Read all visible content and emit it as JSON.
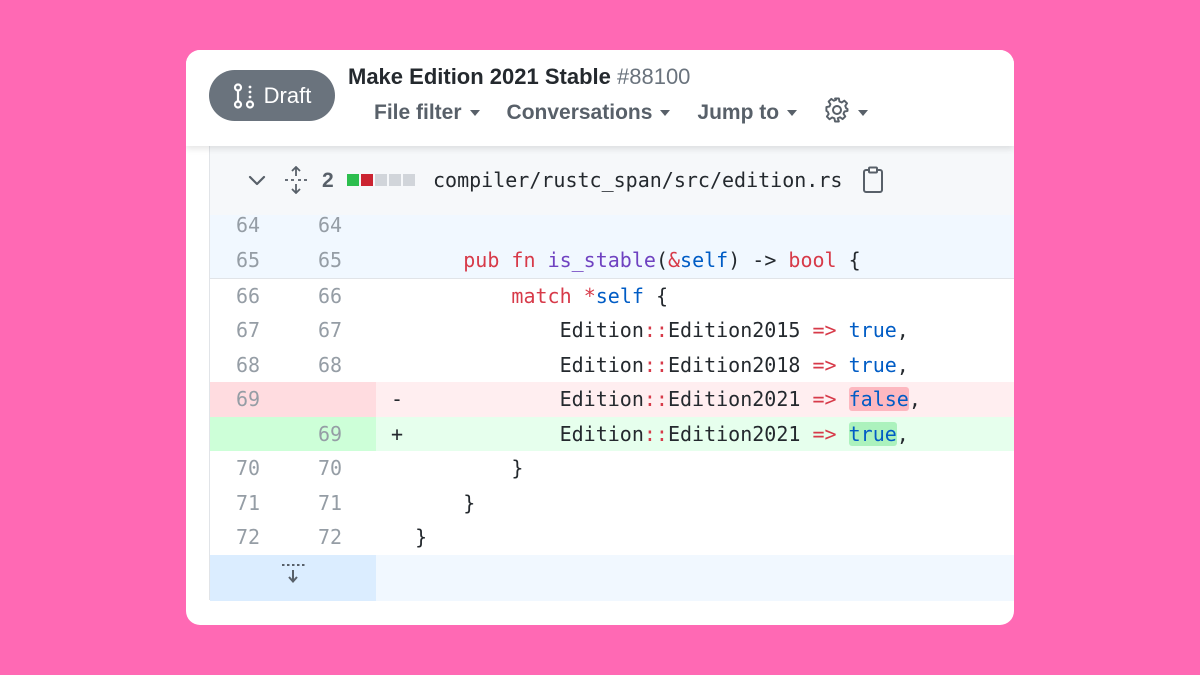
{
  "header": {
    "badge_label": "Draft",
    "title": "Make Edition 2021 Stable",
    "number": "#88100",
    "toolbar": [
      {
        "label": "File filter"
      },
      {
        "label": "Conversations"
      },
      {
        "label": "Jump to"
      }
    ]
  },
  "file": {
    "changes_count": "2",
    "diffstat": [
      "added",
      "removed",
      "neutral",
      "neutral",
      "neutral"
    ],
    "path": "compiler/rustc_span/src/edition.rs"
  },
  "diff": {
    "rows": [
      {
        "old": "64",
        "new": "64",
        "sign": "",
        "text": ""
      },
      {
        "old": "65",
        "new": "65",
        "sign": "",
        "text": "pub fn is_stable(&self) -> bool {"
      },
      {
        "old": "66",
        "new": "66",
        "sign": "",
        "text": "match *self {"
      },
      {
        "old": "67",
        "new": "67",
        "sign": "",
        "text": "Edition::Edition2015 => true,"
      },
      {
        "old": "68",
        "new": "68",
        "sign": "",
        "text": "Edition::Edition2018 => true,"
      },
      {
        "old": "69",
        "new": "",
        "sign": "-",
        "text": "Edition::Edition2021 => false,"
      },
      {
        "old": "",
        "new": "69",
        "sign": "+",
        "text": "Edition::Edition2021 => true,"
      },
      {
        "old": "70",
        "new": "70",
        "sign": "",
        "text": "}"
      },
      {
        "old": "71",
        "new": "71",
        "sign": "",
        "text": "}"
      },
      {
        "old": "72",
        "new": "72",
        "sign": "",
        "text": "}"
      }
    ]
  },
  "colors": {
    "background": "#ff69b4",
    "badge": "#6a737d",
    "deleted_line": "#ffeef0",
    "added_line": "#e6ffed"
  },
  "icons": [
    "git-pull-request-draft-icon",
    "chevron-down-icon",
    "unfold-icon",
    "copy-icon",
    "gear-icon",
    "expand-down-icon"
  ]
}
